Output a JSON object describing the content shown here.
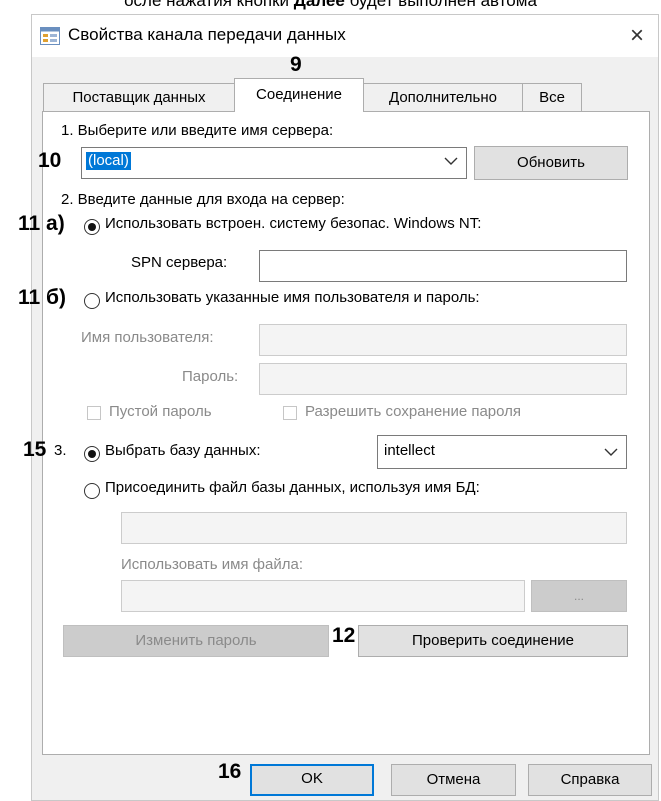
{
  "caption": {
    "prefix": "осле нажатия кнопки ",
    "bold": "Далее",
    "suffix": " будет выполнен автома"
  },
  "window": {
    "title": "Свойства канала передачи данных",
    "close": "×"
  },
  "tabs": [
    {
      "label": "Поставщик данных"
    },
    {
      "label": "Соединение"
    },
    {
      "label": "Дополнительно"
    },
    {
      "label": "Все"
    }
  ],
  "markers": {
    "m9": "9",
    "m10": "10",
    "m11a": "11 а)",
    "m11b": "11 б)",
    "m15": "15",
    "m12": "12",
    "m16": "16"
  },
  "step1": {
    "label": "1. Выберите или введите имя сервера:",
    "server_value": "(local)",
    "refresh": "Обновить"
  },
  "step2": {
    "label": "2. Введите данные для входа на сервер:",
    "opt_windows": "Использовать встроен. систему безопас. Windows NT:",
    "spn_label": "SPN сервера:",
    "spn_value": "",
    "opt_user": "Использовать указанные имя пользователя и пароль:",
    "username_label": "Имя пользователя:",
    "password_label": "Пароль:",
    "empty_password": "Пустой пароль",
    "allow_save": "Разрешить сохранение пароля"
  },
  "step3": {
    "num": "3.",
    "opt_select_db": "Выбрать базу данных:",
    "db_value": "intellect",
    "opt_attach": "Присоединить файл базы данных, используя имя БД:",
    "filename_label": "Использовать имя файла:",
    "browse": "..."
  },
  "buttons": {
    "change_password": "Изменить пароль",
    "test": "Проверить соединение",
    "ok": "OK",
    "cancel": "Отмена",
    "help": "Справка"
  },
  "colors": {
    "accent": "#0078d7",
    "panel": "#ffffff",
    "client": "#f0f0f0"
  }
}
